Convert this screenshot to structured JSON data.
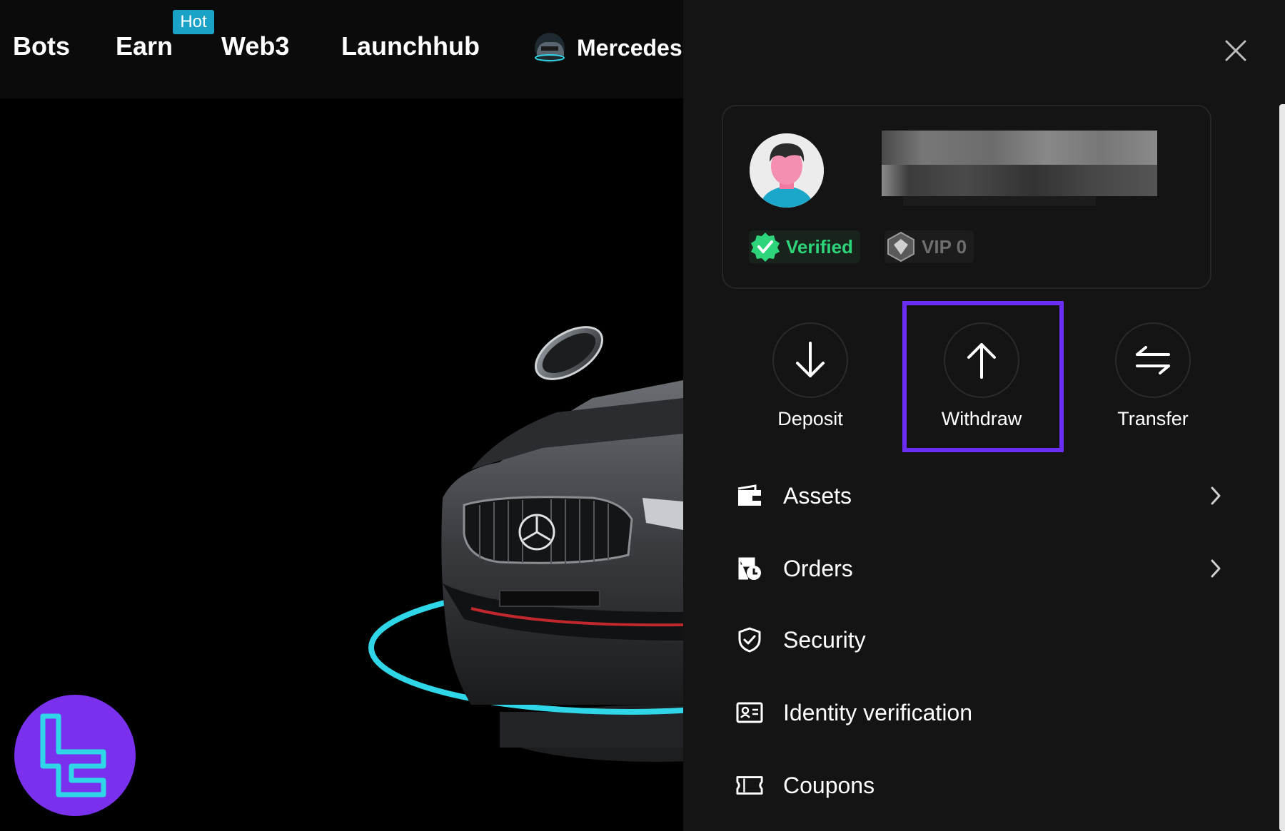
{
  "nav": {
    "items": [
      {
        "label": "Bots"
      },
      {
        "label": "Earn"
      },
      {
        "label": "Web3"
      },
      {
        "label": "Launchhub"
      }
    ],
    "hot_badge": "Hot",
    "promo_label": "Mercedes"
  },
  "drawer": {
    "user": {
      "verified_label": "Verified",
      "vip_label": "VIP 0"
    },
    "actions": [
      {
        "label": "Deposit",
        "icon": "arrow-down-icon"
      },
      {
        "label": "Withdraw",
        "icon": "arrow-up-icon",
        "highlighted": true
      },
      {
        "label": "Transfer",
        "icon": "transfer-arrows-icon"
      }
    ],
    "menu": [
      {
        "label": "Assets",
        "icon": "wallet-icon",
        "has_chevron": true
      },
      {
        "label": "Orders",
        "icon": "orders-clock-icon",
        "has_chevron": true
      },
      {
        "label": "Security",
        "icon": "shield-check-icon",
        "has_chevron": false
      },
      {
        "label": "Identity verification",
        "icon": "id-card-icon",
        "has_chevron": false
      },
      {
        "label": "Coupons",
        "icon": "ticket-icon",
        "has_chevron": false
      }
    ]
  },
  "colors": {
    "drawer_bg": "#141414",
    "highlight": "#6b2ef5",
    "verified_green": "#2ed47a",
    "hot_badge": "#1aa3c7",
    "watermark": "#7a31ee",
    "ring_cyan": "#2fd6e8"
  }
}
